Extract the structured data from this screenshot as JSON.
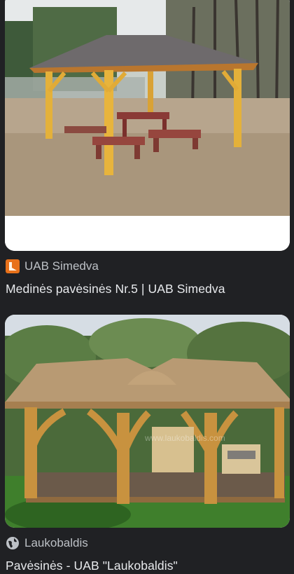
{
  "results": [
    {
      "source": "UAB Simedva",
      "source_icon": "simedva-logo-icon",
      "title": "Medinės pavėsinės Nr.5 | UAB Simedva",
      "image": "wooden-gazebo-with-picnic-tables",
      "icon_color": "#e8711a"
    },
    {
      "source": "Laukobaldis",
      "source_icon": "globe-icon",
      "title": "Pavėsinės - UAB \"Laukobaldis\"",
      "image": "log-gazebo-with-shingle-roof",
      "watermark": "www.laukobaldis.com"
    }
  ],
  "colors": {
    "background": "#202124",
    "title": "#e8eaed",
    "source": "#bdc1c6"
  }
}
